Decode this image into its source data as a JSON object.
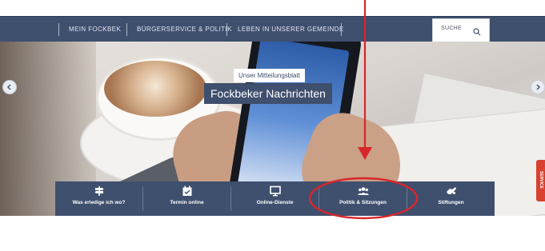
{
  "nav": {
    "items": [
      {
        "label": "MEIN FOCKBEK"
      },
      {
        "label": "BÜRGERSERVICE & POLITIK"
      },
      {
        "label": "LEBEN IN UNSERER GEMEINDE"
      }
    ],
    "search_label": "SUCHE"
  },
  "hero": {
    "subtitle": "Unser Mitteilungsblatt",
    "title": "Fockbeker Nachrichten"
  },
  "quicklinks": [
    {
      "label": "Was erledige ich wo?",
      "icon": "signpost-icon"
    },
    {
      "label": "Termin online",
      "icon": "calendar-check-icon"
    },
    {
      "label": "Online-Dienste",
      "icon": "monitor-icon"
    },
    {
      "label": "Politik & Sitzungen",
      "icon": "people-group-icon"
    },
    {
      "label": "Stiftungen",
      "icon": "handshake-icon"
    }
  ],
  "side_tab": {
    "label": "SERVICE"
  },
  "colors": {
    "nav_bg": "#3f4f6e",
    "annotation_red": "#d9262b",
    "side_tab": "#d8402f"
  }
}
